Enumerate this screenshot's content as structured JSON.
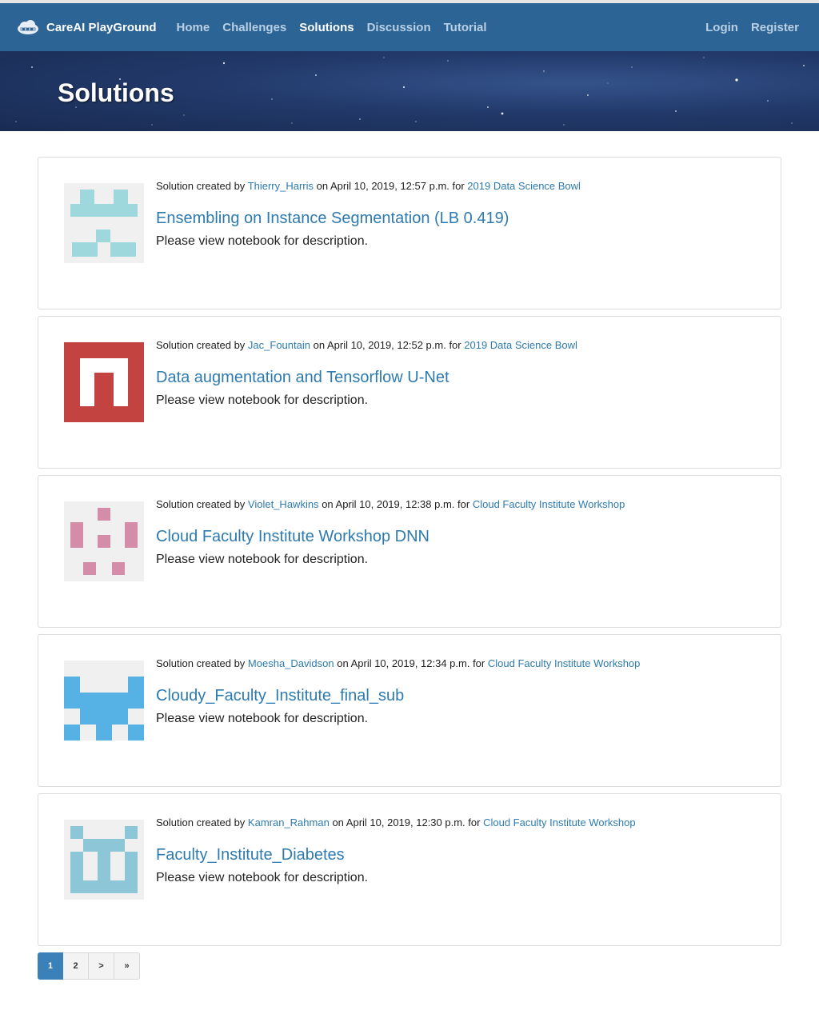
{
  "brand": {
    "name": "CareAI PlayGround",
    "icon": "cloud-logo-icon"
  },
  "nav": {
    "links": [
      {
        "label": "Home",
        "active": false
      },
      {
        "label": "Challenges",
        "active": false
      },
      {
        "label": "Solutions",
        "active": true
      },
      {
        "label": "Discussion",
        "active": false
      },
      {
        "label": "Tutorial",
        "active": false
      }
    ],
    "login": "Login",
    "register": "Register"
  },
  "hero": {
    "title": "Solutions"
  },
  "solutions": [
    {
      "prefix": "Solution created by",
      "author": "Thierry_Harris",
      "date_text": "on April 10, 2019, 12:57 p.m. for",
      "challenge": "2019 Data Science Bowl",
      "title": "Ensembling on Instance Segmentation (LB 0.419)",
      "description": "Please view notebook for description.",
      "avatar_color": "#9fd8dc",
      "avatar_bg": "#f0f0f0"
    },
    {
      "prefix": "Solution created by",
      "author": "Jac_Fountain",
      "date_text": "on April 10, 2019, 12:52 p.m. for",
      "challenge": "2019 Data Science Bowl",
      "title": "Data augmentation and Tensorflow U-Net",
      "description": "Please view notebook for description.",
      "avatar_color": "#c2433f",
      "avatar_bg": "#ffffff"
    },
    {
      "prefix": "Solution created by",
      "author": "Violet_Hawkins",
      "date_text": "on April 10, 2019, 12:38 p.m. for",
      "challenge": "Cloud Faculty Institute Workshop",
      "title": "Cloud Faculty Institute Workshop DNN",
      "description": "Please view notebook for description.",
      "avatar_color": "#d58ca8",
      "avatar_bg": "#f0f0f0"
    },
    {
      "prefix": "Solution created by",
      "author": "Moesha_Davidson",
      "date_text": "on April 10, 2019, 12:34 p.m. for",
      "challenge": "Cloud Faculty Institute Workshop",
      "title": "Cloudy_Faculty_Institute_final_sub",
      "description": "Please view notebook for description.",
      "avatar_color": "#56b2e5",
      "avatar_bg": "#f0f0f0"
    },
    {
      "prefix": "Solution created by",
      "author": "Kamran_Rahman",
      "date_text": "on April 10, 2019, 12:30 p.m. for",
      "challenge": "Cloud Faculty Institute Workshop",
      "title": "Faculty_Institute_Diabetes",
      "description": "Please view notebook for description.",
      "avatar_color": "#8cc6d7",
      "avatar_bg": "#f0f0f0"
    }
  ],
  "pagination": {
    "pages": [
      {
        "label": "1",
        "active": true
      },
      {
        "label": "2",
        "active": false
      },
      {
        "label": ">",
        "active": false
      },
      {
        "label": "»",
        "active": false
      }
    ]
  }
}
